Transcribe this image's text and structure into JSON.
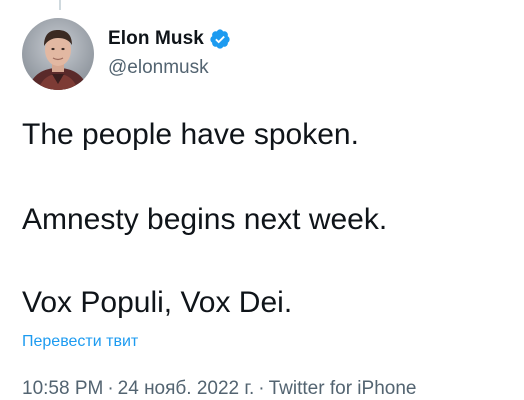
{
  "author": {
    "display_name": "Elon Musk",
    "handle": "@elonmusk",
    "verified": true,
    "verified_icon": "verified-badge-icon"
  },
  "tweet": {
    "lines": [
      "The people have spoken.",
      "Amnesty begins next week.",
      "Vox Populi, Vox Dei."
    ],
    "translate_label": "Перевести твит"
  },
  "meta": {
    "time": "10:58 PM",
    "separator": "·",
    "date": "24 нояб. 2022 г.",
    "source": "Twitter for iPhone"
  },
  "colors": {
    "text": "#0f1419",
    "secondary": "#536471",
    "accent": "#1d9bf0"
  }
}
